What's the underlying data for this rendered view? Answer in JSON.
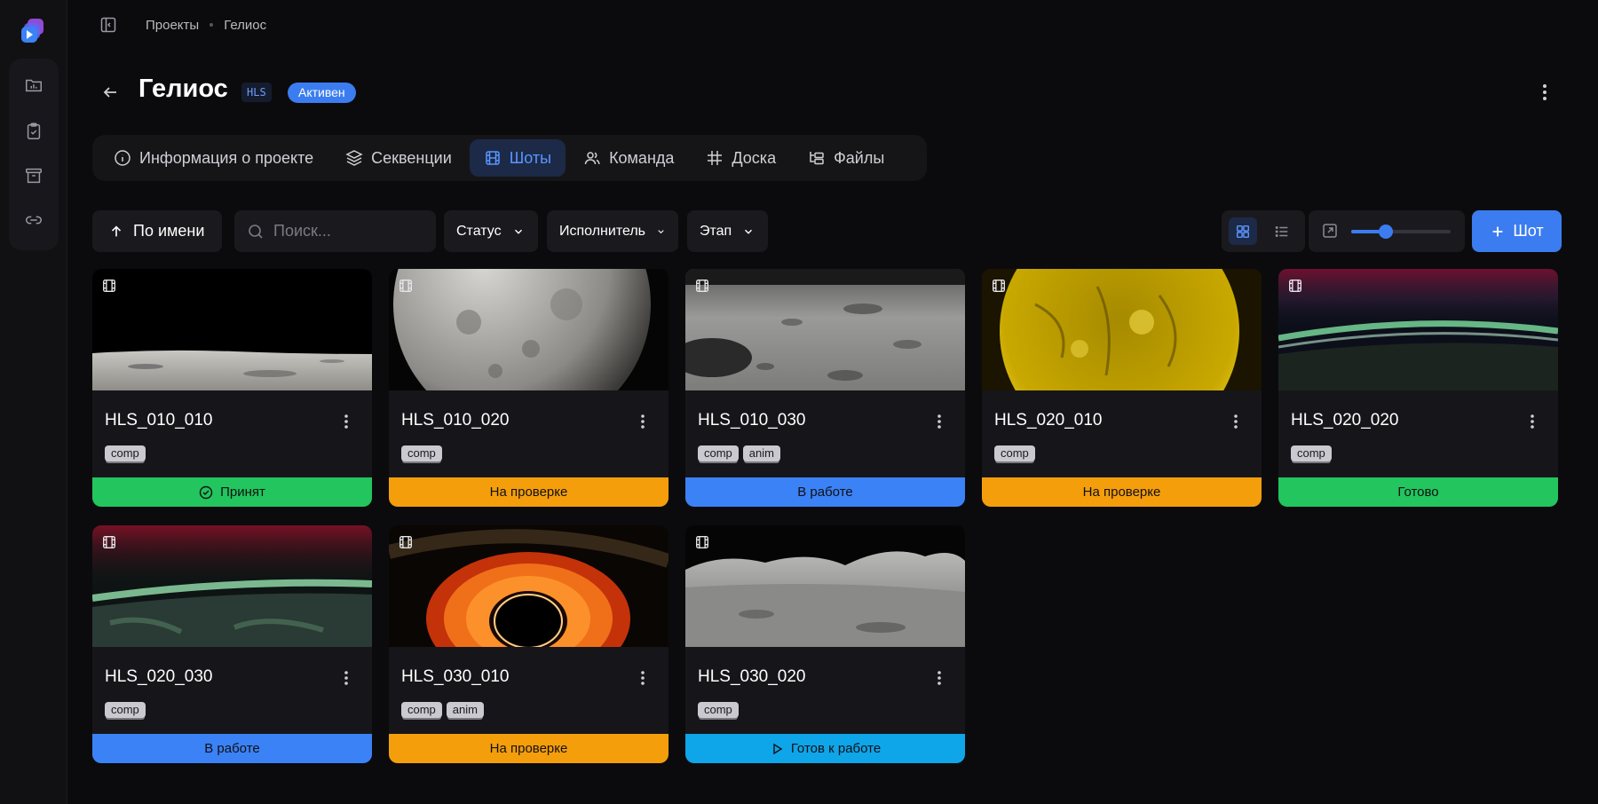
{
  "breadcrumb": {
    "root": "Проекты",
    "current": "Гелиос"
  },
  "project": {
    "title": "Гелиос",
    "code": "HLS",
    "status": "Активен"
  },
  "tabs": [
    {
      "label": "Информация о проекте",
      "icon": "info-icon"
    },
    {
      "label": "Секвенции",
      "icon": "layers-icon"
    },
    {
      "label": "Шоты",
      "icon": "film-icon",
      "active": true
    },
    {
      "label": "Команда",
      "icon": "users-icon"
    },
    {
      "label": "Доска",
      "icon": "hash-icon"
    },
    {
      "label": "Файлы",
      "icon": "folder-tree-icon"
    }
  ],
  "toolbar": {
    "sort_label": "По имени",
    "search_placeholder": "Поиск...",
    "filters": [
      "Статус",
      "Исполнитель",
      "Этап"
    ],
    "add_label": "Шот",
    "zoom": 0.35
  },
  "colors": {
    "accent": "#3b7df0",
    "done": "#22c55e",
    "review": "#f59e0b",
    "progress": "#3b82f6",
    "ready": "#0ea5e9"
  },
  "shots": [
    {
      "name": "HLS_010_010",
      "tags": [
        "comp"
      ],
      "status": "Принят",
      "status_color": "#22c55e",
      "status_icon": "check-circle-icon",
      "thumb": "moon-horizon"
    },
    {
      "name": "HLS_010_020",
      "tags": [
        "comp"
      ],
      "status": "На проверке",
      "status_color": "#f59e0b",
      "status_icon": "",
      "thumb": "moon-sphere"
    },
    {
      "name": "HLS_010_030",
      "tags": [
        "comp",
        "anim"
      ],
      "status": "В работе",
      "status_color": "#3b82f6",
      "status_icon": "",
      "thumb": "craters"
    },
    {
      "name": "HLS_020_010",
      "tags": [
        "comp"
      ],
      "status": "На проверке",
      "status_color": "#f59e0b",
      "status_icon": "",
      "thumb": "sun"
    },
    {
      "name": "HLS_020_020",
      "tags": [
        "comp"
      ],
      "status": "Готово",
      "status_color": "#22c55e",
      "status_icon": "",
      "thumb": "aurora"
    },
    {
      "name": "HLS_020_030",
      "tags": [
        "comp"
      ],
      "status": "В работе",
      "status_color": "#3b82f6",
      "status_icon": "",
      "thumb": "aurora-earth"
    },
    {
      "name": "HLS_030_010",
      "tags": [
        "comp",
        "anim"
      ],
      "status": "На проверке",
      "status_color": "#f59e0b",
      "status_icon": "",
      "thumb": "black-hole"
    },
    {
      "name": "HLS_030_020",
      "tags": [
        "comp"
      ],
      "status": "Готов к работе",
      "status_color": "#0ea5e9",
      "status_icon": "play-icon",
      "thumb": "moon-surface"
    }
  ]
}
